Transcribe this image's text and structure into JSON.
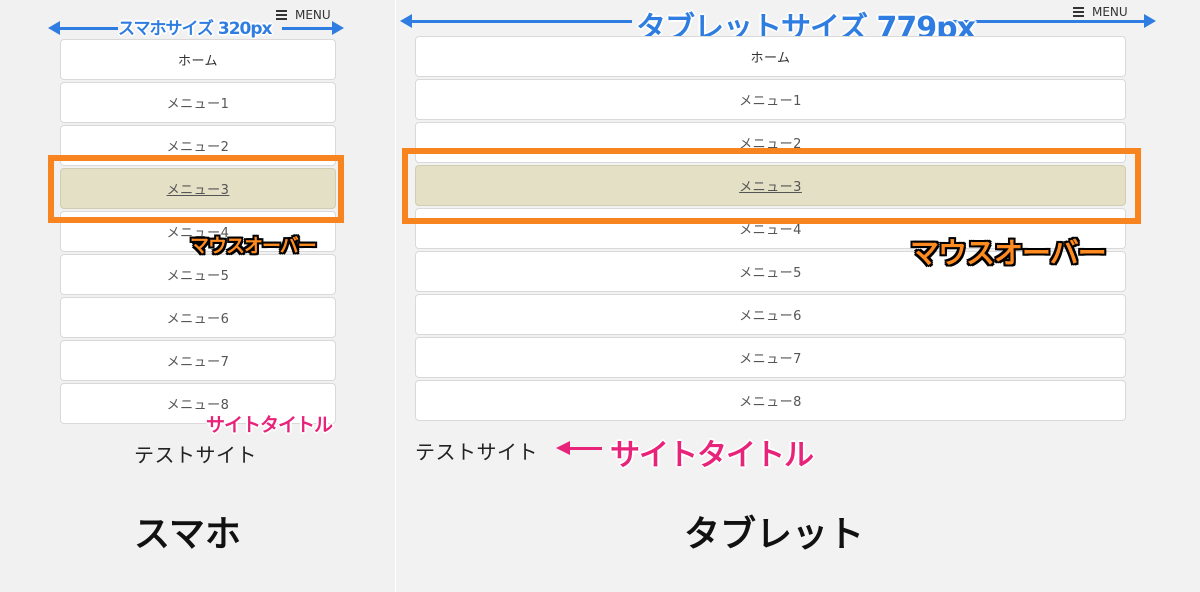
{
  "phone": {
    "size_label": "スマホサイズ 320px",
    "menu_toggle_label": "MENU",
    "menu_items": [
      "ホーム",
      "メニュー1",
      "メニュー2",
      "メニュー3",
      "メニュー4",
      "メニュー5",
      "メニュー6",
      "メニュー7",
      "メニュー8"
    ],
    "hovered_item": "メニュー3",
    "hover_callout": "マウスオーバー",
    "site_title": "テストサイト",
    "site_title_callout": "サイトタイトル",
    "device_label": "スマホ"
  },
  "tablet": {
    "size_label": "タブレットサイズ 779px",
    "menu_toggle_label": "MENU",
    "menu_items": [
      "ホーム",
      "メニュー1",
      "メニュー2",
      "メニュー3",
      "メニュー4",
      "メニュー5",
      "メニュー6",
      "メニュー7",
      "メニュー8"
    ],
    "hovered_item": "メニュー3",
    "hover_callout": "マウスオーバー",
    "site_title": "テストサイト",
    "site_title_callout": "サイトタイトル",
    "device_label": "タブレット"
  },
  "colors": {
    "hover_background": "#e3e0c5",
    "highlight_border": "#f7841e",
    "size_arrow": "#2f7de1",
    "title_callout": "#e8237a"
  },
  "icons": [
    "hamburger-icon",
    "left-arrow-icon",
    "right-arrow-icon"
  ]
}
